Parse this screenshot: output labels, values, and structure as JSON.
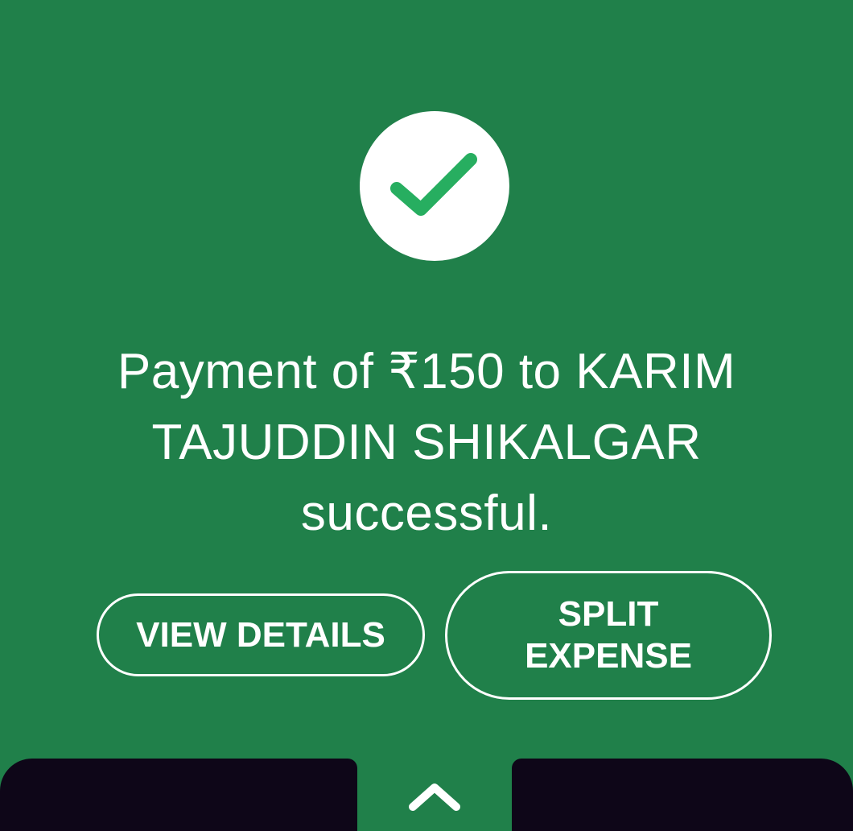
{
  "status": {
    "icon": "checkmark-icon",
    "message": "Payment of ₹150 to KARIM TAJUDDIN SHIKALGAR successful."
  },
  "actions": {
    "view_details_label": "VIEW DETAILS",
    "split_expense_label": "SPLIT EXPENSE"
  },
  "bottom_sheet": {
    "handle_icon": "chevron-up-icon"
  },
  "colors": {
    "background": "#20804a",
    "check": "#27ae60",
    "text": "#ffffff",
    "bottom_bar": "#0e0618"
  }
}
